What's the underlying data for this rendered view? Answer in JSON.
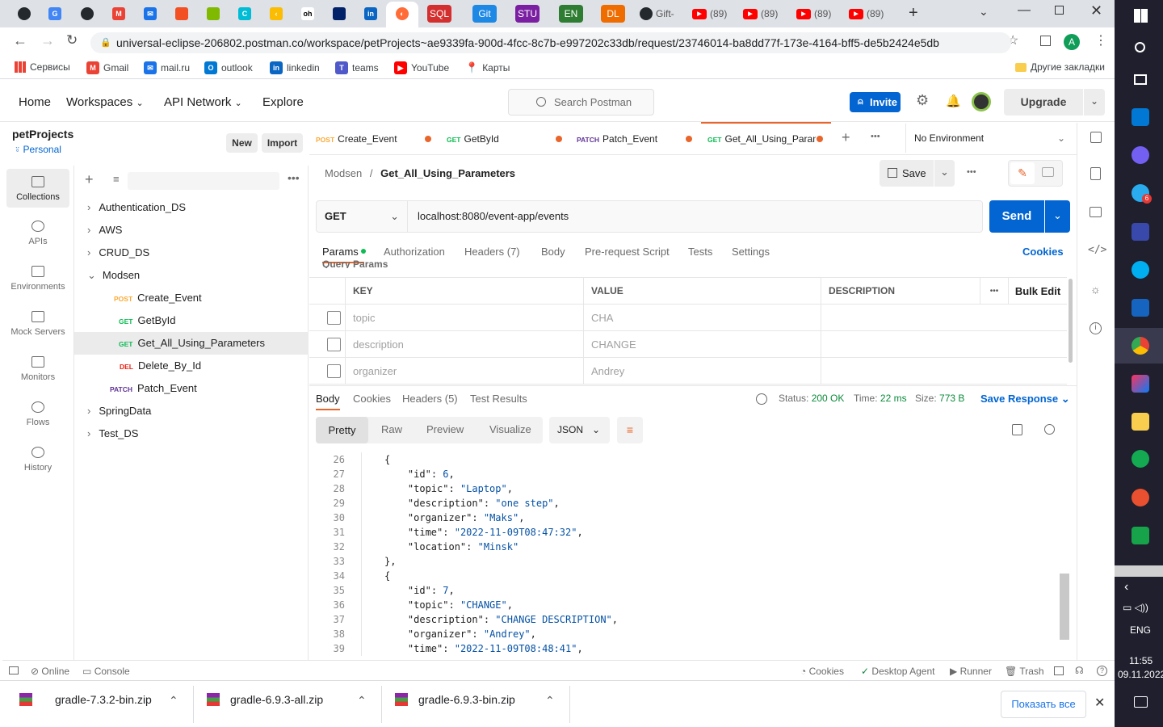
{
  "browser": {
    "tabs": [
      {
        "label": "Gift-",
        "icon": "github-icon"
      },
      {
        "label": "(89)",
        "icon": "youtube-icon"
      },
      {
        "label": "(89)",
        "icon": "youtube-icon"
      },
      {
        "label": "(89)",
        "icon": "youtube-icon"
      },
      {
        "label": "(89)",
        "icon": "youtube-icon"
      }
    ],
    "pinned_tabs": [
      "SQL",
      "Git",
      "STU",
      "EN",
      "DL",
      "oh"
    ],
    "url": "universal-eclipse-206802.postman.co/workspace/petProjects~ae9339fa-900d-4fcc-8c7b-e997202c33db/request/23746014-ba8dd77f-173e-4164-bff5-de5b2424e5db",
    "profile_initial": "A",
    "bookmarks": [
      "Сервисы",
      "Gmail",
      "mail.ru",
      "outlook",
      "linkedin",
      "teams",
      "YouTube",
      "Карты"
    ],
    "other_bookmarks": "Другие закладки"
  },
  "postman": {
    "nav": [
      "Home",
      "Workspaces",
      "API Network",
      "Explore"
    ],
    "search_placeholder": "Search Postman",
    "invite": "Invite",
    "upgrade": "Upgrade",
    "workspace_name": "petProjects",
    "workspace_type": "Personal",
    "new_btn": "New",
    "import_btn": "Import",
    "rail": [
      "Collections",
      "APIs",
      "Environments",
      "Mock Servers",
      "Monitors",
      "Flows",
      "History"
    ],
    "tree": [
      {
        "label": "Authentication_DS",
        "method": "",
        "level": 0
      },
      {
        "label": "AWS",
        "method": "",
        "level": 0
      },
      {
        "label": "CRUD_DS",
        "method": "",
        "level": 0
      },
      {
        "label": "Modsen",
        "method": "",
        "level": 0
      },
      {
        "label": "Create_Event",
        "method": "POST",
        "level": 1
      },
      {
        "label": "GetById",
        "method": "GET",
        "level": 1
      },
      {
        "label": "Get_All_Using_Parameters",
        "method": "GET",
        "level": 1
      },
      {
        "label": "Delete_By_Id",
        "method": "DEL",
        "level": 1
      },
      {
        "label": "Patch_Event",
        "method": "PATCH",
        "level": 1
      },
      {
        "label": "SpringData",
        "method": "",
        "level": 0
      },
      {
        "label": "Test_DS",
        "method": "",
        "level": 0
      }
    ],
    "request_tabs": [
      {
        "method": "POST",
        "name": "Create_Event"
      },
      {
        "method": "GET",
        "name": "GetById"
      },
      {
        "method": "PATCH",
        "name": "Patch_Event"
      },
      {
        "method": "GET",
        "name": "Get_All_Using_Param"
      }
    ],
    "environment": "No Environment",
    "breadcrumb_parent": "Modsen",
    "breadcrumb_current": "Get_All_Using_Parameters",
    "save": "Save",
    "method": "GET",
    "request_url": "localhost:8080/event-app/events",
    "send": "Send",
    "req_tabs": [
      "Params",
      "Authorization",
      "Headers (7)",
      "Body",
      "Pre-request Script",
      "Tests",
      "Settings"
    ],
    "cookies": "Cookies",
    "query_params_label": "Query Params",
    "param_headers": {
      "key": "KEY",
      "value": "VALUE",
      "description": "DESCRIPTION",
      "bulk": "Bulk Edit"
    },
    "params": [
      {
        "key": "topic",
        "value": "CHA",
        "description": ""
      },
      {
        "key": "description",
        "value": "CHANGE",
        "description": ""
      },
      {
        "key": "organizer",
        "value": "Andrey",
        "description": ""
      }
    ],
    "resp_tabs": [
      "Body",
      "Cookies",
      "Headers (5)",
      "Test Results"
    ],
    "status_label": "Status:",
    "status": "200 OK",
    "time_label": "Time:",
    "time": "22 ms",
    "size_label": "Size:",
    "size": "773 B",
    "save_response": "Save Response",
    "view_modes": [
      "Pretty",
      "Raw",
      "Preview",
      "Visualize"
    ],
    "format": "JSON",
    "code_lines": [
      {
        "n": "26",
        "text": "{"
      },
      {
        "n": "27",
        "text": "    \"id\": 6,"
      },
      {
        "n": "28",
        "text": "    \"topic\": \"Laptop\","
      },
      {
        "n": "29",
        "text": "    \"description\": \"one step\","
      },
      {
        "n": "30",
        "text": "    \"organizer\": \"Maks\","
      },
      {
        "n": "31",
        "text": "    \"time\": \"2022-11-09T08:47:32\","
      },
      {
        "n": "32",
        "text": "    \"location\": \"Minsk\""
      },
      {
        "n": "33",
        "text": "},"
      },
      {
        "n": "34",
        "text": "{"
      },
      {
        "n": "35",
        "text": "    \"id\": 7,"
      },
      {
        "n": "36",
        "text": "    \"topic\": \"CHANGE\","
      },
      {
        "n": "37",
        "text": "    \"description\": \"CHANGE DESCRIPTION\","
      },
      {
        "n": "38",
        "text": "    \"organizer\": \"Andrey\","
      },
      {
        "n": "39",
        "text": "    \"time\": \"2022-11-09T08:48:41\","
      }
    ],
    "footer_left": [
      "Online",
      "Console"
    ],
    "footer_right": [
      "Cookies",
      "Desktop Agent",
      "Runner",
      "Trash"
    ]
  },
  "downloads": {
    "items": [
      "gradle-7.3.2-bin.zip",
      "gradle-6.9.3-all.zip",
      "gradle-6.9.3-bin.zip"
    ],
    "show_all": "Показать все"
  },
  "windows": {
    "lang": "ENG",
    "time": "11:55",
    "date": "09.11.2022",
    "badge": "6"
  }
}
